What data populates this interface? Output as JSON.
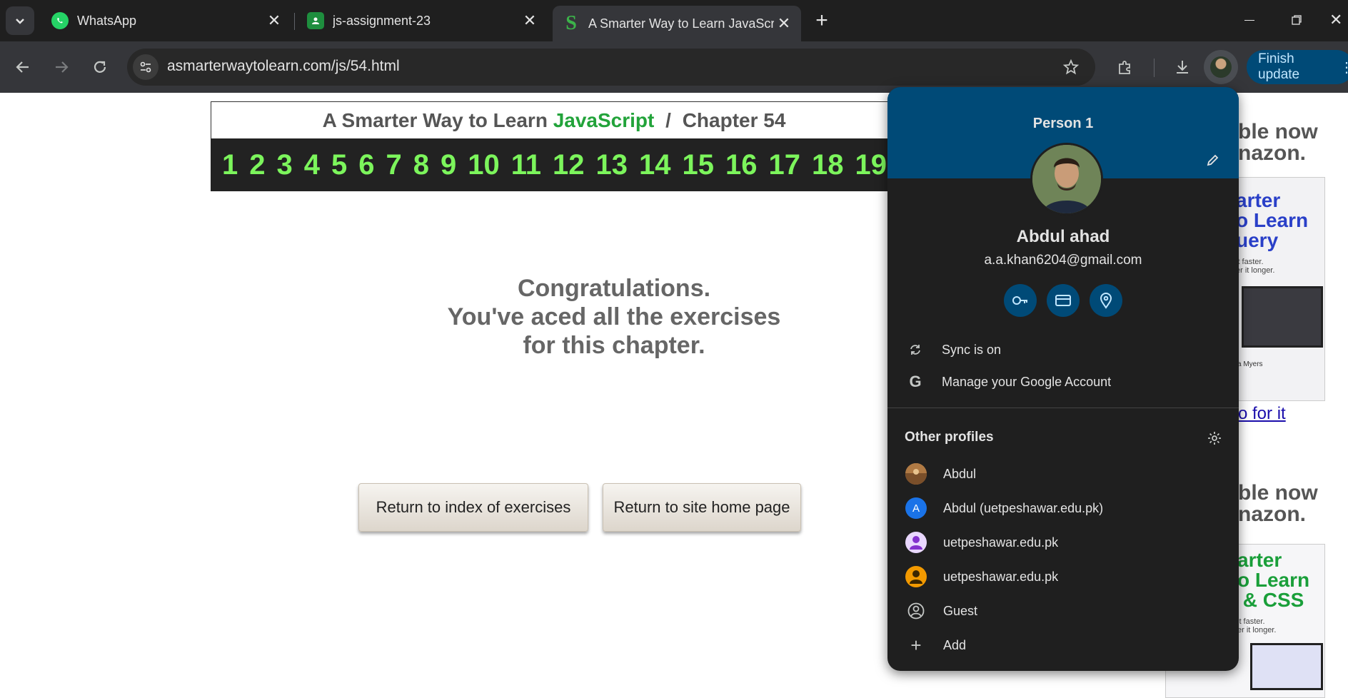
{
  "tabs": [
    {
      "title": "WhatsApp",
      "icon": "whatsapp-icon"
    },
    {
      "title": "js-assignment-23",
      "icon": "classroom-icon"
    },
    {
      "title": "A Smarter Way to Learn JavaScr",
      "icon": "smarter-way-icon",
      "active": true
    }
  ],
  "toolbar": {
    "url": "asmarterwaytolearn.com/js/54.html",
    "finish_update": "Finish update"
  },
  "page": {
    "header_prefix": "A Smarter Way to Learn",
    "header_js": "JavaScript",
    "header_sep": "/",
    "header_chapter": "Chapter 54",
    "numbers": [
      "1",
      "2",
      "3",
      "4",
      "5",
      "6",
      "7",
      "8",
      "9",
      "10",
      "11",
      "12",
      "13",
      "14",
      "15",
      "16",
      "17",
      "18",
      "19"
    ],
    "congrats_line1": "Congratulations.",
    "congrats_line2": "You've aced all the exercises",
    "congrats_line3": "for this chapter.",
    "btn_index": "Return to index of exercises",
    "btn_home": "Return to site home page"
  },
  "ads": {
    "ad1_line1": "ble now",
    "ad1_line2": "nazon.",
    "book1_title": "arter\no Learn\nuery",
    "book1_sub": "it faster.\ner it longer.",
    "book1_author": "a Myers",
    "link": "o for it",
    "ad2_line1": "ble now",
    "ad2_line2": "nazon.",
    "book2_title": "arter\no Learn\n & CSS",
    "book2_sub": "it faster.\ner it longer."
  },
  "profile": {
    "header": "Person 1",
    "name": "Abdul ahad",
    "email": "a.a.khan6204@gmail.com",
    "sync": "Sync is on",
    "manage": "Manage your Google Account",
    "other_profiles": "Other profiles",
    "profiles": [
      {
        "name": "Abdul",
        "avatar": "photo"
      },
      {
        "name": "Abdul (uetpeshawar.edu.pk)",
        "avatar": "letter",
        "letter": "A",
        "color": "#1a73e8"
      },
      {
        "name": "uetpeshawar.edu.pk",
        "avatar": "person",
        "color": "#8430ce"
      },
      {
        "name": "uetpeshawar.edu.pk",
        "avatar": "person",
        "color": "#f29900"
      }
    ],
    "guest": "Guest",
    "add": "Add"
  }
}
